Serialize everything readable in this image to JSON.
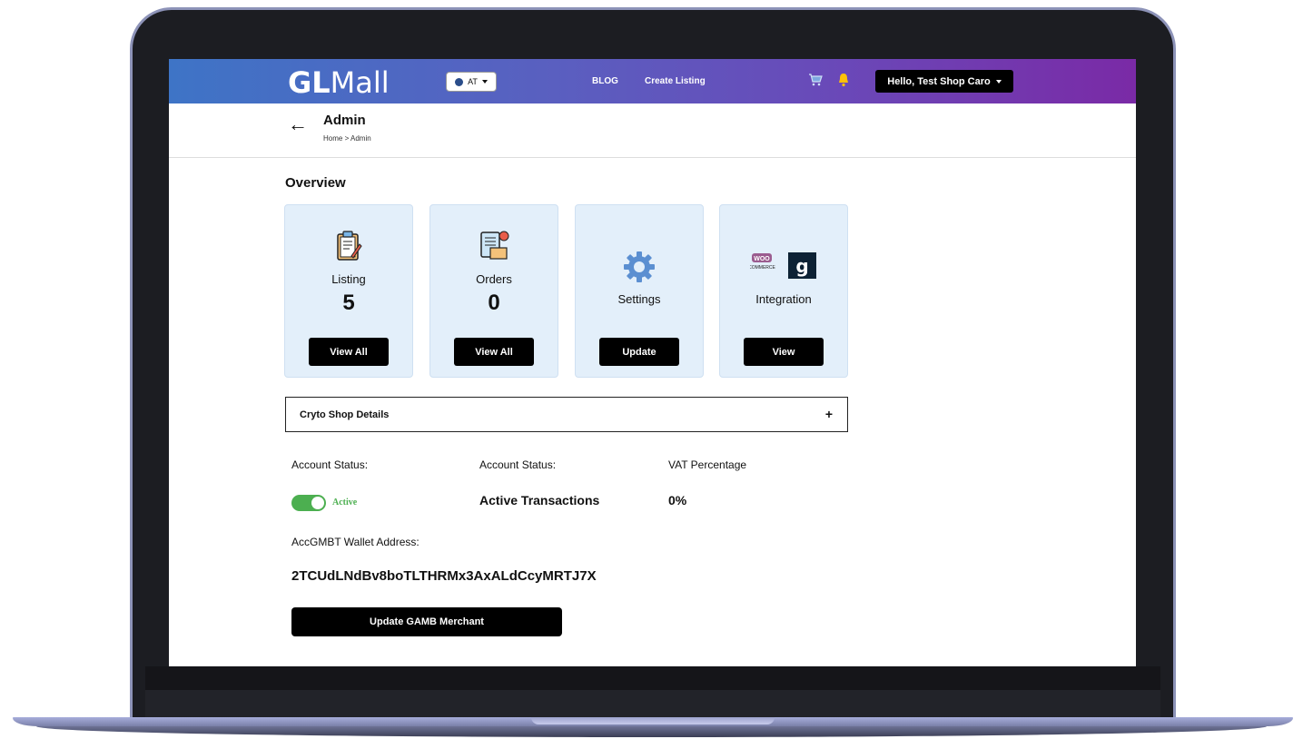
{
  "navbar": {
    "logo_bold": "GL",
    "logo_thin": "Mall",
    "region": "AT",
    "links": [
      "BLOG",
      "Create Listing"
    ],
    "user_menu": "Hello, Test Shop Caro"
  },
  "header": {
    "title": "Admin",
    "breadcrumb": "Home > Admin"
  },
  "overview": {
    "title": "Overview",
    "cards": [
      {
        "label": "Listing",
        "value": "5",
        "button": "View All",
        "icon": "clipboard-icon"
      },
      {
        "label": "Orders",
        "value": "0",
        "button": "View All",
        "icon": "orders-icon"
      },
      {
        "label": "Settings",
        "value": "",
        "button": "Update",
        "icon": "gear-icon"
      },
      {
        "label": "Integration",
        "value": "",
        "button": "View",
        "icon": "integration-icon"
      }
    ]
  },
  "shop_details": {
    "title": "Cryto Shop Details",
    "toggle_symbol": "+"
  },
  "account": {
    "status_label_1": "Account Status:",
    "status_label_2": "Account Status:",
    "vat_label": "VAT Percentage",
    "toggle_state": "Active",
    "transactions": "Active Transactions",
    "vat_value": "0%",
    "wallet_label": "AccGMBT Wallet Address:",
    "wallet_address": "2TCUdLNdBv8boTLTHRMx3AxALdCcyMRTJ7X",
    "merchant_button": "Update GAMB Merchant"
  },
  "colors": {
    "navbar_start": "#3e74c6",
    "navbar_end": "#7a2aa6",
    "card_bg": "#e3effa",
    "toggle_on": "#4caf50"
  }
}
